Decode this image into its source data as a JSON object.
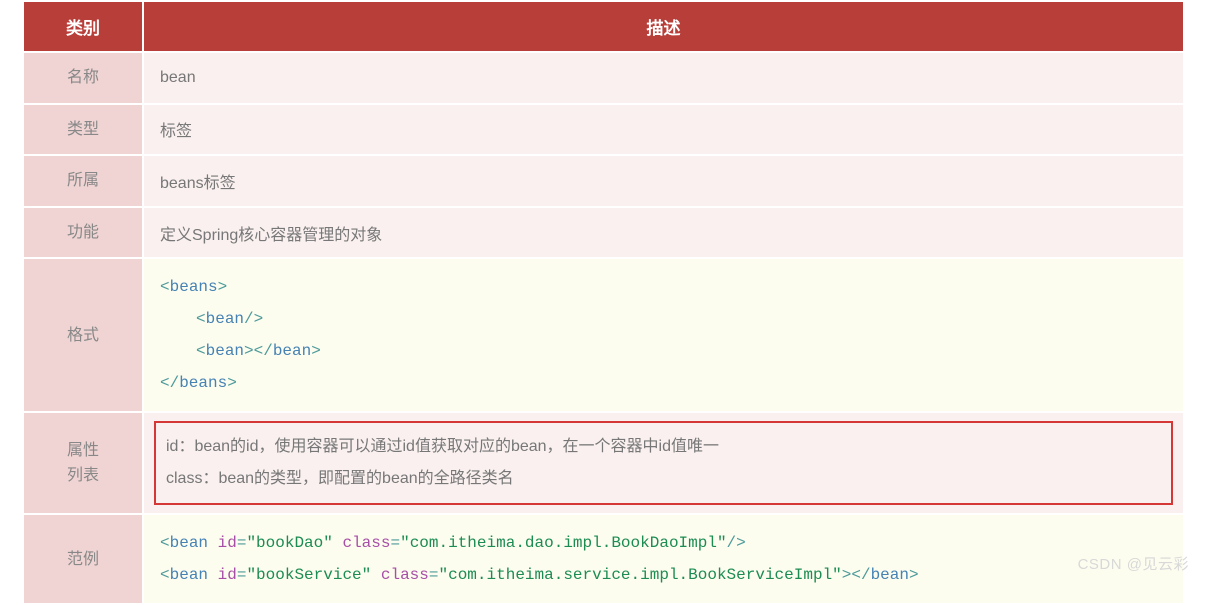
{
  "header": {
    "col1": "类别",
    "col2": "描述"
  },
  "rows": {
    "name": {
      "label": "名称",
      "value": "bean"
    },
    "type": {
      "label": "类型",
      "value": "标签"
    },
    "parent": {
      "label": "所属",
      "value": "beans标签"
    },
    "func": {
      "label": "功能",
      "value": "定义Spring核心容器管理的对象"
    },
    "format": {
      "label": "格式",
      "code": {
        "open_tag": "beans",
        "child_self": "bean",
        "child_pair": "bean",
        "close_tag": "beans"
      }
    },
    "attrs": {
      "label_line1": "属性",
      "label_line2": "列表",
      "line1": "id：bean的id，使用容器可以通过id值获取对应的bean，在一个容器中id值唯一",
      "line2": "class：bean的类型，即配置的bean的全路径类名"
    },
    "example": {
      "label": "范例",
      "ex1": {
        "tag": "bean",
        "id_attr": "id",
        "id_val": "\"bookDao\"",
        "class_attr": "class",
        "class_val": "\"com.itheima.dao.impl.BookDaoImpl\""
      },
      "ex2": {
        "tag": "bean",
        "id_attr": "id",
        "id_val": "\"bookService\"",
        "class_attr": "class",
        "class_val": "\"com.itheima.service.impl.BookServiceImpl\""
      }
    }
  },
  "watermark": "CSDN @见云彩"
}
